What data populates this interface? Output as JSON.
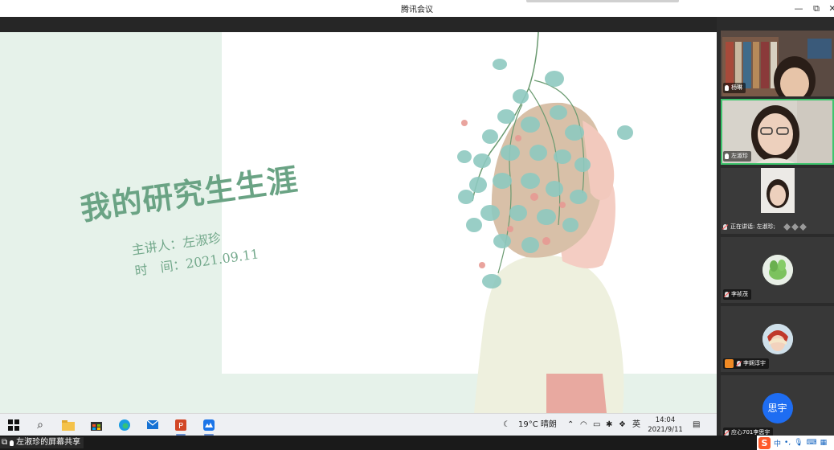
{
  "window": {
    "title": "腾讯会议",
    "controls": {
      "minimize": "—",
      "restore": "⧉",
      "close": "✕"
    }
  },
  "slide": {
    "title": "我的研究生生涯",
    "speaker_line": "主讲人：左淑珍",
    "date_line": "时　间：2021.09.11"
  },
  "participants": [
    {
      "name": "杨琳",
      "mic": "on"
    },
    {
      "name": "左淑珍",
      "mic": "on",
      "active": true
    },
    {
      "speaking_label": "正在讲话: 左淑珍;"
    },
    {
      "name": "李祯茂",
      "mic": "muted"
    },
    {
      "name": "李娴淳宇",
      "mic": "muted"
    },
    {
      "name": "应心701李思宇",
      "mic": "muted",
      "avatar_text": "思宇"
    }
  ],
  "taskbar": {
    "weather": "19°C 晴朗",
    "ime_lang": "英",
    "time": "14:04",
    "date": "2021/9/11"
  },
  "status": {
    "share_label": "左淑珍的屏幕共享"
  },
  "ime": {
    "logo": "S",
    "lang": "中"
  },
  "colors": {
    "accent_green": "#3ec46d",
    "slide_title": "#6aa384",
    "panel_bg": "#e6f2ea",
    "avatar_blue": "#1e6df2"
  }
}
